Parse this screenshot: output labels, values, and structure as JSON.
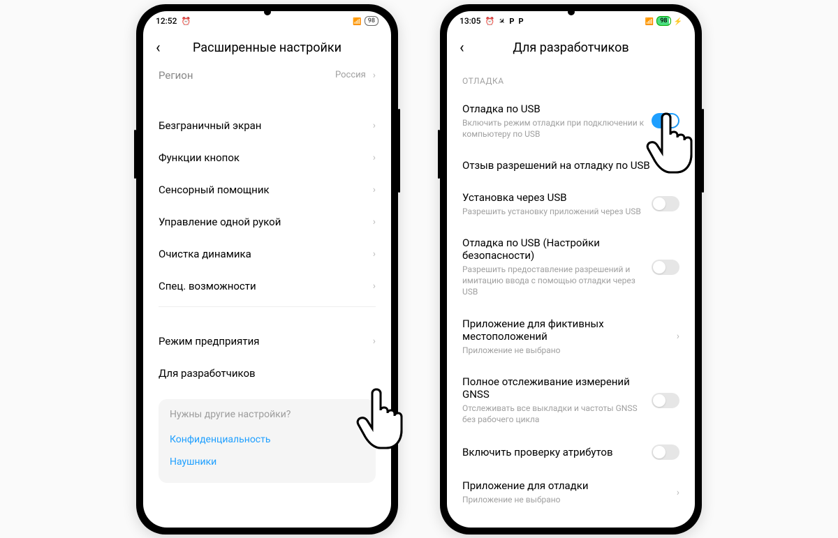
{
  "phone1": {
    "status": {
      "time": "12:52",
      "battery": "98"
    },
    "title": "Расширенные настройки",
    "region": {
      "label": "Регион",
      "value": "Россия"
    },
    "rows": [
      "Безграничный экран",
      "Функции кнопок",
      "Сенсорный помощник",
      "Управление одной рукой",
      "Очистка динамика",
      "Спец. возможности"
    ],
    "rows2": [
      "Режим предприятия",
      "Для разработчиков"
    ],
    "card": {
      "hint": "Нужны другие настройки?",
      "links": [
        "Конфиденциальность",
        "Наушники"
      ]
    }
  },
  "phone2": {
    "status": {
      "time": "13:05",
      "battery": "98"
    },
    "title": "Для разработчиков",
    "section": "ОТЛАДКА",
    "items": {
      "usb_debug": {
        "title": "Отладка по USB",
        "sub": "Включить режим отладки при подключении к компьютеру по USB"
      },
      "revoke": {
        "title": "Отзыв разрешений на отладку по USB"
      },
      "install_usb": {
        "title": "Установка через USB",
        "sub": "Разрешить установку приложений через USB"
      },
      "usb_security": {
        "title": "Отладка по USB (Настройки безопасности)",
        "sub": "Разрешить предоставление разрешений и имитацию ввода с помощью отладки через USB"
      },
      "mock_location": {
        "title": "Приложение для фиктивных местоположений",
        "sub": "Приложение не выбрано"
      },
      "gnss": {
        "title": "Полное отслеживание измерений GNSS",
        "sub": "Отслеживать все выкладки и частоты GNSS без рабочего цикла"
      },
      "attr_check": {
        "title": "Включить проверку атрибутов"
      },
      "debug_app": {
        "title": "Приложение для отладки",
        "sub": "Приложение не выбрано"
      }
    }
  }
}
